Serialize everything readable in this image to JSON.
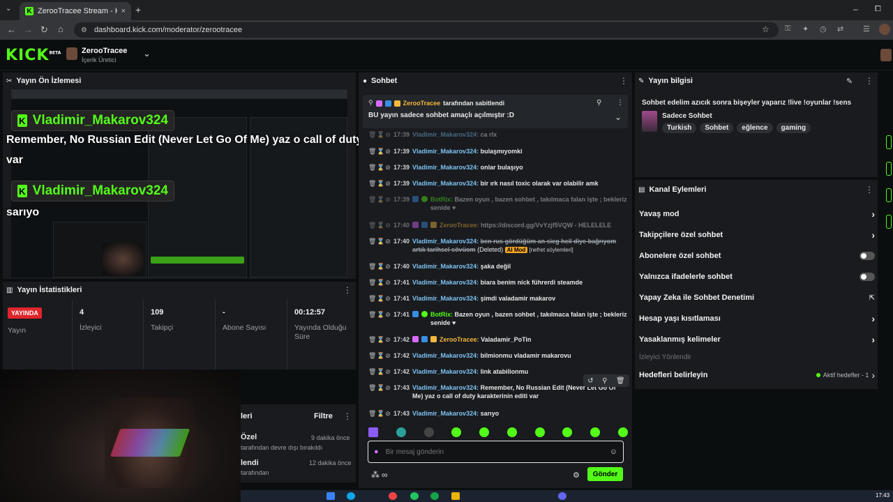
{
  "browser": {
    "tab_title": "ZerooTracee Stream - Kick Dash",
    "tab_close": "×",
    "new_tab": "+",
    "url": "dashboard.kick.com/moderator/zerootracee",
    "window_controls": {
      "minimize": "–",
      "restore": "⧠"
    }
  },
  "header": {
    "logo": "KICK",
    "logo_beta": "BETA",
    "channel_name": "ZerooTracee",
    "channel_role": "İçerik Üretici"
  },
  "preview": {
    "title": "Yayın Ön İzlemesi",
    "overlay_user_1": "Vladimir_Makarov324",
    "overlay_msg_1a": "Remember, No Russian Edit (Never Let Go Of Me) yaz o call of duty karakterinin editi",
    "overlay_msg_1b": "var",
    "overlay_user_2": "Vladimir_Makarov324",
    "overlay_msg_2": "sarıyo"
  },
  "stats": {
    "title": "Yayın İstatistikleri",
    "live_badge": "YAYINDA",
    "items": [
      {
        "value": "",
        "label": "Yayın"
      },
      {
        "value": "4",
        "label": "İzleyici"
      },
      {
        "value": "109",
        "label": "Takipçi"
      },
      {
        "value": "-",
        "label": "Abone Sayısı"
      },
      {
        "value": "00:12:57",
        "label": "Yayında Olduğu Süre"
      }
    ]
  },
  "activity": {
    "title_partial": "leri",
    "filter": "Filtre",
    "items": [
      {
        "title": "Özel",
        "sub": "tarafından devre dışı bırakıldı",
        "time": "9 dakika önce"
      },
      {
        "title": "lendi",
        "sub": "tarafından",
        "time": "12 dakika önce"
      }
    ]
  },
  "chat": {
    "title": "Sohbet",
    "pinned_by_user": "ZerooTracee",
    "pinned_by_text": "tarafından sabitlendi",
    "pinned_message": "BU yayın sadece sohbet amaçlı açılmıştır :D",
    "messages": [
      {
        "time": "17:39",
        "user": "Vladimir_Makarov324",
        "text": "ca rlx",
        "style": "faded"
      },
      {
        "time": "17:39",
        "user": "Vladimir_Makarov324",
        "text": "bulaşmıyomki"
      },
      {
        "time": "17:39",
        "user": "Vladimir_Makarov324",
        "text": "onlar bulaşıyo"
      },
      {
        "time": "17:39",
        "user": "Vladimir_Makarov324",
        "text": "bir ırk nasıl toxic olarak var olabilir amk"
      },
      {
        "time": "17:39",
        "user": "BotRix",
        "text": "Bazen oyun , bazen sohbet , takılmaca falan işte ; bekleriz senide ♥",
        "style": "faded"
      },
      {
        "time": "17:40",
        "user": "ZerooTracee",
        "text": "https://discord.gg/VvYzjf5VQW - HELELELE",
        "style": "faded"
      },
      {
        "time": "17:40",
        "user": "Vladimir_Makarov324",
        "text": "ben rus gördüğüm an sieg heil diye bağrıyom artık tarihsel sövüom",
        "deleted": "(Deleted)",
        "ai": "AI Mod",
        "reason": "[nefret söylemleri]"
      },
      {
        "time": "17:40",
        "user": "Vladimir_Makarov324",
        "text": "şaka değil"
      },
      {
        "time": "17:41",
        "user": "Vladimir_Makarov324",
        "text": "biara benim nick führerdi steamde"
      },
      {
        "time": "17:41",
        "user": "Vladimir_Makarov324",
        "text": "şimdi valadamir makarov"
      },
      {
        "time": "17:41",
        "user": "BotRix",
        "text": "Bazen oyun , bazen sohbet , takılmaca falan işte ; bekleriz senide ♥"
      },
      {
        "time": "17:42",
        "user": "ZerooTracee",
        "text": "Valadamir_PoTin"
      },
      {
        "time": "17:42",
        "user": "Vladimir_Makarov324",
        "text": "bilmionmu vladamir makarovu"
      },
      {
        "time": "17:42",
        "user": "Vladimir_Makarov324",
        "text": "link atabilionmu"
      },
      {
        "time": "17:43",
        "user": "Vladimir_Makarov324",
        "text": "Remember, No Russian Edit (Never Let Go Of Me) yaz o call of duty karakterinin editi var"
      },
      {
        "time": "17:43",
        "user": "Vladimir_Makarov324",
        "text": "sarıyo"
      }
    ],
    "input_placeholder": "Bir mesaj gönderin",
    "send_label": "Gönder"
  },
  "stream_info": {
    "title": "Yayın bilgisi",
    "stream_title": "Sohbet edelim azıcık sonra bişeyler yaparız !live !oyunlar !sens",
    "category": "Sadece Sohbet",
    "tags": [
      "Turkish",
      "Sohbet",
      "eğlence",
      "gaming"
    ]
  },
  "channel_actions": {
    "title": "Kanal Eylemleri",
    "items": [
      {
        "label": "Yavaş mod",
        "control": "chevron"
      },
      {
        "label": "Takipçilere özel sohbet",
        "control": "chevron"
      },
      {
        "label": "Abonelere özel sohbet",
        "control": "toggle"
      },
      {
        "label": "Yalnızca ifadelerle sohbet",
        "control": "toggle"
      },
      {
        "label": "Yapay Zeka ile Sohbet Denetimi",
        "control": "external"
      },
      {
        "label": "Hesap yaşı kısıtlaması",
        "control": "chevron"
      },
      {
        "label": "Yasaklanmış kelimeler",
        "control": "chevron"
      }
    ],
    "section_label": "İzleyici Yönlendir",
    "goals_label": "Hedefleri belirleyin",
    "goals_status": "Aktif hedefler - 1"
  },
  "taskbar": {
    "clock": "17:43"
  },
  "colors": {
    "kick_green": "#53fc18",
    "panel_bg": "#191b1f",
    "page_bg": "#0b0e0f",
    "username_blue": "#7ec3f2",
    "username_gold": "#f5b83d"
  }
}
